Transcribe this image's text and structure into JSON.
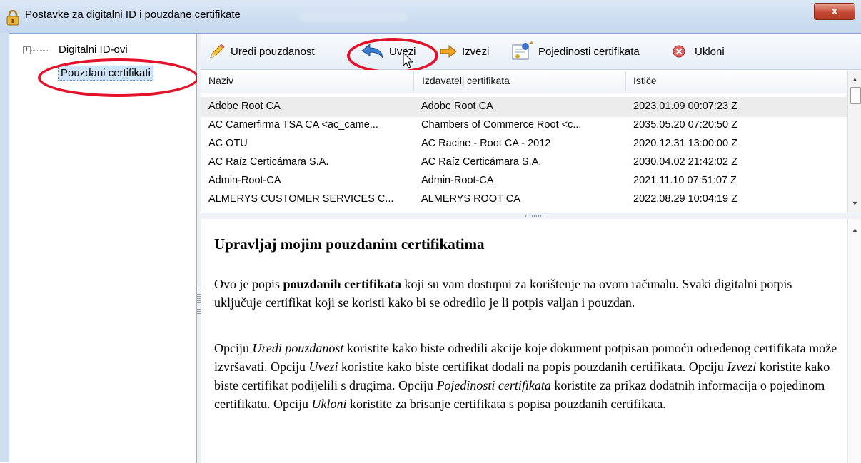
{
  "window": {
    "title": "Postavke za digitalni ID i pouzdane certifikate",
    "close_glyph": "x"
  },
  "tree": {
    "expander": "+",
    "items": [
      {
        "label": "Digitalni ID-ovi"
      },
      {
        "label": "Pouzdani certifikati",
        "selected": true
      }
    ]
  },
  "toolbar": {
    "edit_trust": "Uredi pouzdanost",
    "import": "Uvezi",
    "export": "Izvezi",
    "details": "Pojedinosti certifikata",
    "remove": "Ukloni"
  },
  "grid": {
    "columns": [
      "Naziv",
      "Izdavatelj certifikata",
      "Ističe"
    ],
    "rows": [
      [
        "Adobe Root CA",
        "Adobe Root CA",
        "2023.01.09 00:07:23 Z"
      ],
      [
        "AC Camerfirma TSA CA <ac_came...",
        "Chambers of Commerce Root <c...",
        "2035.05.20 07:20:50 Z"
      ],
      [
        "AC OTU",
        "AC Racine - Root CA - 2012",
        "2020.12.31 13:00:00 Z"
      ],
      [
        "AC Raíz Certicámara S.A.",
        "AC Raíz Certicámara S.A.",
        "2030.04.02 21:42:02 Z"
      ],
      [
        "Admin-Root-CA",
        "Admin-Root-CA",
        "2021.11.10 07:51:07 Z"
      ],
      [
        "ALMERYS CUSTOMER SERVICES C...",
        "ALMERYS ROOT CA",
        "2022.08.29 10:04:19 Z"
      ]
    ]
  },
  "info": {
    "heading": "Upravljaj mojim pouzdanim certifikatima",
    "p1_before": "Ovo je popis ",
    "p1_bold": "pouzdanih certifikata",
    "p1_after": " koji su vam dostupni za korištenje na ovom računalu. Svaki digitalni potpis uključuje certifikat koji se koristi kako bi se odredilo je li potpis valjan i pouzdan.",
    "p2_a": "Opciju ",
    "p2_edit": "Uredi pouzdanost",
    "p2_b": " koristite kako biste odredili akcije koje dokument potpisan pomoću određenog certifikata može izvršavati. Opciju ",
    "p2_import": "Uvezi",
    "p2_c": " koristite kako biste certifikat dodali na popis pouzdanih certifikata. Opciju ",
    "p2_export": "Izvezi",
    "p2_d": " koristite kako biste certifikat podijelili s drugima. Opciju ",
    "p2_details": "Pojedinosti certifikata",
    "p2_e": " koristite za prikaz dodatnih informacija o pojedinom certifikatu. Opciju ",
    "p2_remove": "Ukloni",
    "p2_f": " koristite za brisanje certifikata s popisa pouzdanih certifikata."
  },
  "colors": {
    "highlight_ring": "#e3122b",
    "selection": "#cde3f7"
  }
}
